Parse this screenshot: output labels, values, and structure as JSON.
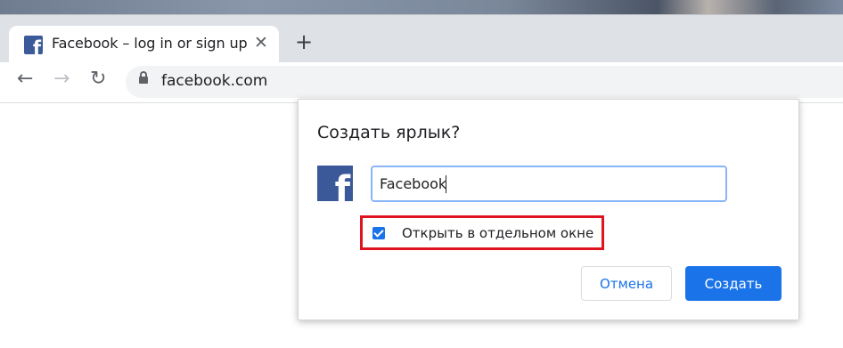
{
  "browser": {
    "tab": {
      "favicon": "facebook-f-icon",
      "title": "Facebook – log in or sign up",
      "close_glyph": "✕"
    },
    "new_tab_glyph": "+",
    "toolbar": {
      "back_glyph": "←",
      "forward_glyph": "→",
      "reload_glyph": "↻",
      "url": "facebook.com"
    }
  },
  "dialog": {
    "title": "Создать ярлык?",
    "app_icon_letter": "f",
    "name_value": "Facebook",
    "checkbox": {
      "checked": true,
      "label": "Открыть в отдельном окне"
    },
    "cancel_label": "Отмена",
    "create_label": "Создать"
  },
  "colors": {
    "accent": "#1a73e8",
    "facebook_blue": "#3b5998",
    "highlight_border": "#e0141e"
  }
}
